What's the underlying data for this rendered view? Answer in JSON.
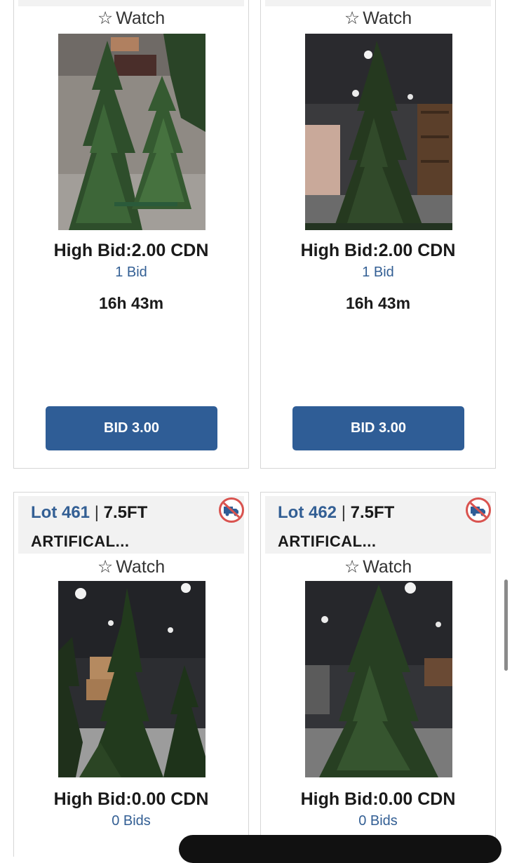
{
  "colors": {
    "link_blue": "#335f94",
    "button_blue": "#2f5d96",
    "card_border": "#d6d6d6",
    "header_bg": "#f2f2f2",
    "no_shipping_red": "#d9534f"
  },
  "top_cards": [
    {
      "watch_label": "Watch",
      "watch_icon": "star-outline-icon",
      "photo_alt": "two small artificial trees",
      "high_bid": "High Bid:2.00 CDN",
      "bids": "1 Bid",
      "time_left": "16h 43m",
      "button_label": "BID 3.00"
    },
    {
      "watch_label": "Watch",
      "watch_icon": "star-outline-icon",
      "photo_alt": "artificial tree in warehouse",
      "high_bid": "High Bid:2.00 CDN",
      "bids": "1 Bid",
      "time_left": "16h 43m",
      "button_label": "BID 3.00"
    }
  ],
  "bottom_cards": [
    {
      "lot_number": "Lot 461",
      "separator": "|",
      "size": "7.5FT",
      "title": "ARTIFICAL...",
      "shipping_icon": "no-shipping-truck-icon",
      "watch_label": "Watch",
      "high_bid": "High Bid:0.00 CDN",
      "bids": "0 Bids"
    },
    {
      "lot_number": "Lot 462",
      "separator": "|",
      "size": "7.5FT",
      "title": "ARTIFICAL...",
      "shipping_icon": "no-shipping-truck-icon",
      "watch_label": "Watch",
      "high_bid": "High Bid:0.00 CDN",
      "bids": "0 Bids"
    }
  ]
}
